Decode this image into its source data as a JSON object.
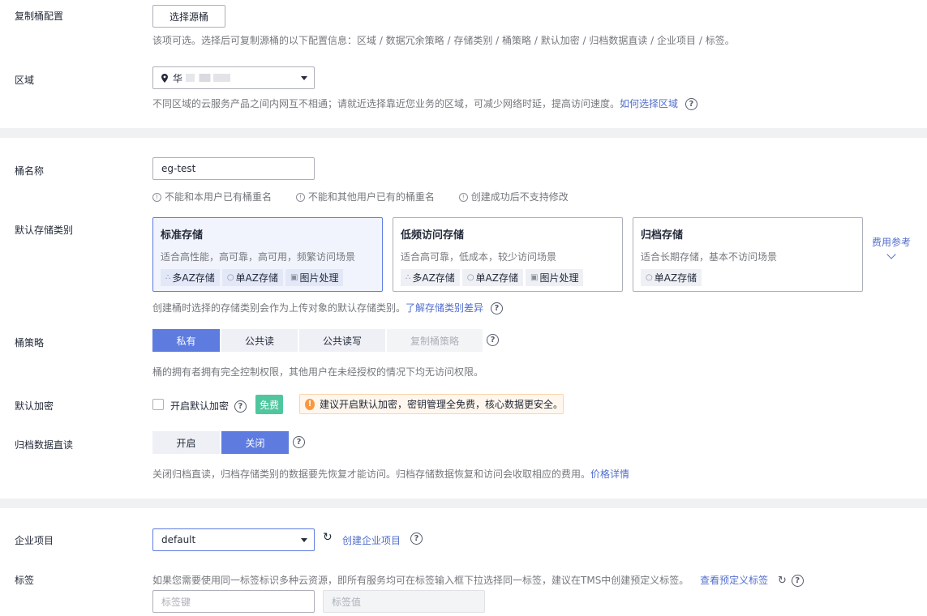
{
  "replication": {
    "label": "复制桶配置",
    "button": "选择源桶",
    "hint": "该项可选。选择后可复制源桶的以下配置信息：区域 / 数据冗余策略 / 存储类别 / 桶策略 / 默认加密 / 归档数据直读 / 企业项目 / 标签。"
  },
  "region": {
    "label": "区域",
    "value": "华",
    "hint": "不同区域的云服务产品之间内网互不相通；请就近选择靠近您业务的区域，可减少网络时延，提高访问速度。",
    "link": "如何选择区域"
  },
  "bucket_name": {
    "label": "桶名称",
    "value": "eg-test",
    "rules": [
      "不能和本用户已有桶重名",
      "不能和其他用户已有的桶重名",
      "创建成功后不支持修改"
    ]
  },
  "storage_class": {
    "label": "默认存储类别",
    "cards": [
      {
        "title": "标准存储",
        "desc": "适合高性能，高可靠，高可用，频繁访问场景",
        "chips": [
          "多AZ存储",
          "单AZ存储",
          "图片处理"
        ]
      },
      {
        "title": "低频访问存储",
        "desc": "适合高可靠，低成本，较少访问场景",
        "chips": [
          "多AZ存储",
          "单AZ存储",
          "图片处理"
        ]
      },
      {
        "title": "归档存储",
        "desc": "适合长期存储，基本不访问场景",
        "chips": [
          "单AZ存储"
        ]
      }
    ],
    "fee_link": "费用参考",
    "hint": "创建桶时选择的存储类别会作为上传对象的默认存储类别。",
    "hint_link": "了解存储类别差异"
  },
  "policy": {
    "label": "桶策略",
    "options": [
      "私有",
      "公共读",
      "公共读写",
      "复制桶策略"
    ],
    "hint": "桶的拥有者拥有完全控制权限，其他用户在未经授权的情况下均无访问权限。"
  },
  "encryption": {
    "label": "默认加密",
    "checkbox_label": "开启默认加密",
    "badge": "免费",
    "notice": "建议开启默认加密，密钥管理全免费，核心数据更安全。"
  },
  "archive_read": {
    "label": "归档数据直读",
    "options": [
      "开启",
      "关闭"
    ],
    "hint": "关闭归档直读，归档存储类别的数据要先恢复才能访问。归档存储数据恢复和访问会收取相应的费用。",
    "link": "价格详情"
  },
  "enterprise": {
    "label": "企业项目",
    "value": "default",
    "link": "创建企业项目"
  },
  "tags": {
    "label": "标签",
    "hint": "如果您需要使用同一标签标识多种云资源，即所有服务均可在标签输入框下拉选择同一标签，建议在TMS中创建预定义标签。",
    "link": "查看预定义标签",
    "key_placeholder": "标签键",
    "value_placeholder": "标签值"
  }
}
